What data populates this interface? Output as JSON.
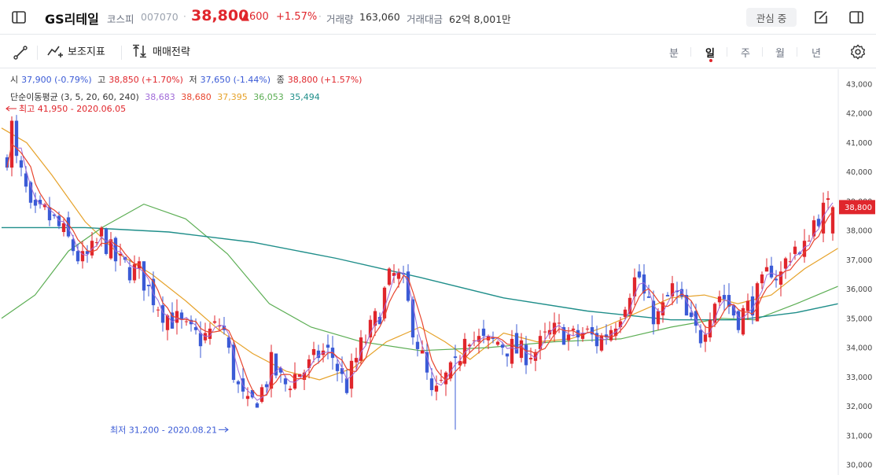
{
  "header": {
    "stock_name": "GS리테일",
    "market": "코스피",
    "code": "007070",
    "price": "38,800",
    "change": "▲600",
    "change_pct": "+1.57%",
    "volume_label": "거래량",
    "volume_value": "163,060",
    "amount_label": "거래대금",
    "amount_value": "62억 8,001만",
    "watch_button": "관심 중"
  },
  "toolbar": {
    "indicators_label": "보조지표",
    "strategy_label": "매매전략",
    "periods": [
      "분",
      "일",
      "주",
      "월",
      "년"
    ],
    "active_period": "일"
  },
  "ohlc_legend": {
    "open_label": "시",
    "open_value": "37,900 (-0.79%)",
    "high_label": "고",
    "high_value": "38,850 (+1.70%)",
    "low_label": "저",
    "low_value": "37,650 (-1.44%)",
    "close_label": "종",
    "close_value": "38,800 (+1.57%)"
  },
  "ma_legend": {
    "label": "단순이동평균 (3, 5, 20, 60, 240)",
    "values": [
      {
        "value": "38,683",
        "color": "#a06ad8"
      },
      {
        "value": "38,680",
        "color": "#e8452e"
      },
      {
        "value": "37,395",
        "color": "#e6a22a"
      },
      {
        "value": "36,053",
        "color": "#5cae54"
      },
      {
        "value": "35,494",
        "color": "#1f8e8a"
      }
    ]
  },
  "annotations": {
    "high": "최고 41,950 - 2020.06.05",
    "low": "최저 31,200 - 2020.08.21"
  },
  "colors": {
    "up": "#e0262c",
    "down": "#3b5bd6",
    "ma3": "#a06ad8",
    "ma5": "#e8452e",
    "ma20": "#e6a22a",
    "ma60": "#5cae54",
    "ma240": "#1f8e8a"
  },
  "chart_data": {
    "type": "candlestick",
    "y_ticks": [
      "43,000",
      "42,000",
      "41,000",
      "40,000",
      "39,000",
      "38,000",
      "37,000",
      "36,000",
      "35,000",
      "34,000",
      "33,000",
      "32,000",
      "31,000",
      "30,000"
    ],
    "ylim": [
      30000,
      43000
    ],
    "current_price_tag": "38,800",
    "current_price": 38800,
    "high_value": 41950,
    "low_value": 31200,
    "ma240": [
      [
        0,
        38100
      ],
      [
        0.1,
        38100
      ],
      [
        0.2,
        37950
      ],
      [
        0.3,
        37600
      ],
      [
        0.4,
        37050
      ],
      [
        0.5,
        36400
      ],
      [
        0.6,
        35700
      ],
      [
        0.7,
        35250
      ],
      [
        0.8,
        34950
      ],
      [
        0.88,
        34950
      ],
      [
        0.95,
        35200
      ],
      [
        1.0,
        35500
      ]
    ],
    "ma60": [
      [
        0,
        35000
      ],
      [
        0.04,
        35800
      ],
      [
        0.08,
        37300
      ],
      [
        0.12,
        38100
      ],
      [
        0.17,
        38900
      ],
      [
        0.22,
        38400
      ],
      [
        0.27,
        37200
      ],
      [
        0.32,
        35500
      ],
      [
        0.37,
        34700
      ],
      [
        0.43,
        34200
      ],
      [
        0.5,
        33900
      ],
      [
        0.58,
        34000
      ],
      [
        0.66,
        34200
      ],
      [
        0.74,
        34300
      ],
      [
        0.8,
        34700
      ],
      [
        0.86,
        35000
      ],
      [
        0.9,
        34950
      ],
      [
        0.95,
        35500
      ],
      [
        1.0,
        36100
      ]
    ],
    "ma20": [
      [
        0,
        41500
      ],
      [
        0.03,
        41000
      ],
      [
        0.06,
        39900
      ],
      [
        0.1,
        38300
      ],
      [
        0.14,
        37200
      ],
      [
        0.18,
        36500
      ],
      [
        0.22,
        35600
      ],
      [
        0.26,
        34600
      ],
      [
        0.3,
        33800
      ],
      [
        0.34,
        33200
      ],
      [
        0.38,
        32900
      ],
      [
        0.42,
        33300
      ],
      [
        0.46,
        34200
      ],
      [
        0.5,
        34700
      ],
      [
        0.53,
        34200
      ],
      [
        0.56,
        33600
      ],
      [
        0.6,
        34500
      ],
      [
        0.64,
        34200
      ],
      [
        0.68,
        34300
      ],
      [
        0.72,
        34700
      ],
      [
        0.76,
        35200
      ],
      [
        0.8,
        35700
      ],
      [
        0.84,
        35800
      ],
      [
        0.88,
        35500
      ],
      [
        0.92,
        35800
      ],
      [
        0.96,
        36700
      ],
      [
        1.0,
        37400
      ]
    ]
  }
}
